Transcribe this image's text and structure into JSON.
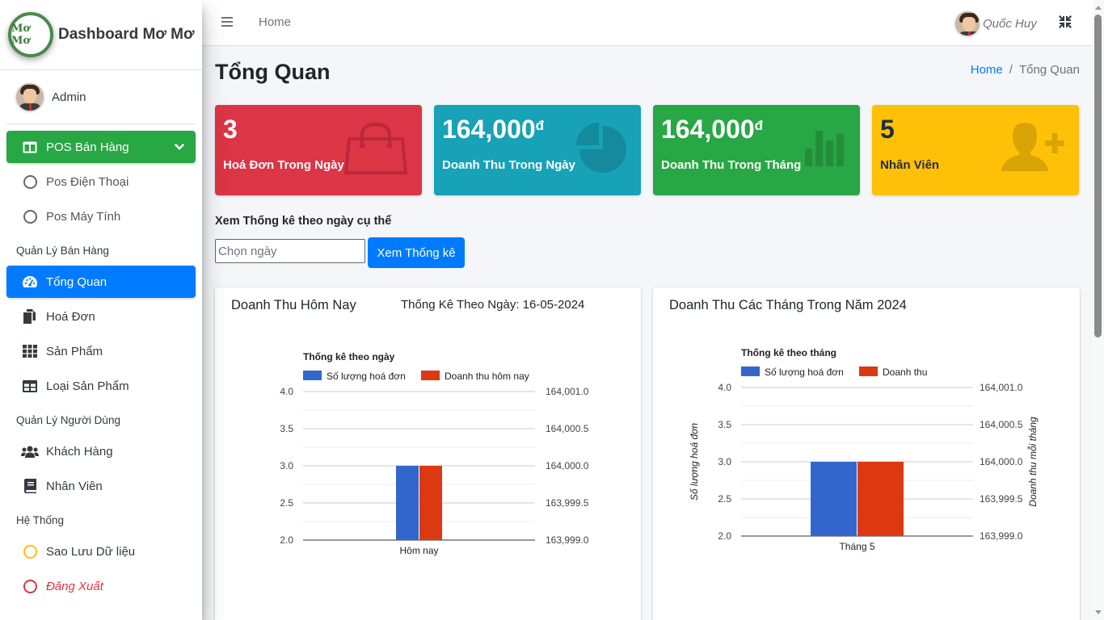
{
  "brand": {
    "title": "Dashboard Mơ Mơ",
    "logo_text": "Mơ Mơ"
  },
  "user_panel": {
    "name": "Admin"
  },
  "sidebar": {
    "pos_menu": {
      "label": "POS Bán Hàng",
      "icon": "columns-icon",
      "color": "#28a745"
    },
    "pos_items": [
      {
        "label": "Pos Điện Thoại",
        "icon": "circle-icon"
      },
      {
        "label": "Pos Máy Tính",
        "icon": "circle-icon"
      }
    ],
    "sections": [
      {
        "header": "Quản Lý Bán Hàng"
      },
      {
        "header": "Quản Lý Người Dùng"
      },
      {
        "header": "Hệ Thống"
      }
    ],
    "sales_items": [
      {
        "label": "Tổng Quan",
        "icon": "tachometer-icon",
        "active": true,
        "color": "#007bff"
      },
      {
        "label": "Hoá Đơn",
        "icon": "copy-icon"
      },
      {
        "label": "Sản Phẩm",
        "icon": "th-icon"
      },
      {
        "label": "Loại Sản Phẩm",
        "icon": "table-icon"
      }
    ],
    "user_items": [
      {
        "label": "Khách Hàng",
        "icon": "users-icon"
      },
      {
        "label": "Nhân Viên",
        "icon": "book-icon"
      }
    ],
    "system_items": [
      {
        "label": "Sao Lưu Dữ liệu",
        "icon": "circle-icon",
        "color": "#ffc107"
      },
      {
        "label": "Đăng Xuất",
        "icon": "circle-icon",
        "color": "#dc3545"
      }
    ]
  },
  "topbar": {
    "home_link": "Home",
    "user_name": "Quốc Huy"
  },
  "page": {
    "title": "Tổng Quan",
    "breadcrumb": {
      "home": "Home",
      "separator": "/",
      "current": "Tổng Quan"
    }
  },
  "stat_boxes": [
    {
      "value": "3",
      "suffix": "",
      "label": "Hoá Đơn Trong Ngày",
      "icon": "shopping-bag-icon",
      "color": "#dc3545"
    },
    {
      "value": "164,000",
      "suffix": "đ",
      "label": "Doanh Thu Trong Ngày",
      "icon": "pie-chart-icon",
      "color": "#17a2b8"
    },
    {
      "value": "164,000",
      "suffix": "đ",
      "label": "Doanh Thu Trong Tháng",
      "icon": "bar-chart-icon",
      "color": "#28a745"
    },
    {
      "value": "5",
      "suffix": "",
      "label": "Nhân Viên",
      "icon": "user-plus-icon",
      "color": "#ffc107"
    }
  ],
  "filter": {
    "label": "Xem Thống kê theo ngày cụ thể",
    "date_placeholder": "Chọn ngày",
    "date_value": "",
    "button_label": "Xem Thống kê"
  },
  "cards": {
    "left": {
      "title": "Doanh Thu Hôm Nay",
      "subtitle": "Thống Kê Theo Ngày: 16-05-2024"
    },
    "right": {
      "title": "Doanh Thu Các Tháng Trong Năm 2024"
    }
  },
  "chart_data": [
    {
      "type": "bar",
      "title": "Thống kê theo ngày",
      "categories": [
        "Hôm nay"
      ],
      "series": [
        {
          "name": "Số lượng hoá đơn",
          "values": [
            3
          ],
          "axis": "left",
          "color": "#3366cc"
        },
        {
          "name": "Doanh thu hôm nay",
          "values": [
            164000
          ],
          "axis": "right",
          "color": "#dc3912"
        }
      ],
      "ylabel": "",
      "y2label": "",
      "ylim": [
        2.0,
        4.0
      ],
      "y2lim": [
        163999.0,
        164001.0
      ],
      "yticks": [
        "4.0",
        "3.5",
        "3.0",
        "2.5",
        "2.0"
      ],
      "y2ticks": [
        "164,001.0",
        "164,000.5",
        "164,000.0",
        "163,999.5",
        "163,999.0"
      ],
      "grid": true,
      "legend": "top"
    },
    {
      "type": "bar",
      "title": "Thống kê theo tháng",
      "categories": [
        "Tháng 5"
      ],
      "series": [
        {
          "name": "Số lượng hoá đơn",
          "values": [
            3
          ],
          "axis": "left",
          "color": "#3366cc"
        },
        {
          "name": "Doanh thu",
          "values": [
            164000
          ],
          "axis": "right",
          "color": "#dc3912"
        }
      ],
      "ylabel": "Số lượng hoá đơn",
      "y2label": "Doanh thu mỗi tháng",
      "ylim": [
        2.0,
        4.0
      ],
      "y2lim": [
        163999.0,
        164001.0
      ],
      "yticks": [
        "4.0",
        "3.5",
        "3.0",
        "2.5",
        "2.0"
      ],
      "y2ticks": [
        "164,001.0",
        "164,000.5",
        "164,000.0",
        "163,999.5",
        "163,999.0"
      ],
      "grid": true,
      "legend": "top"
    }
  ]
}
